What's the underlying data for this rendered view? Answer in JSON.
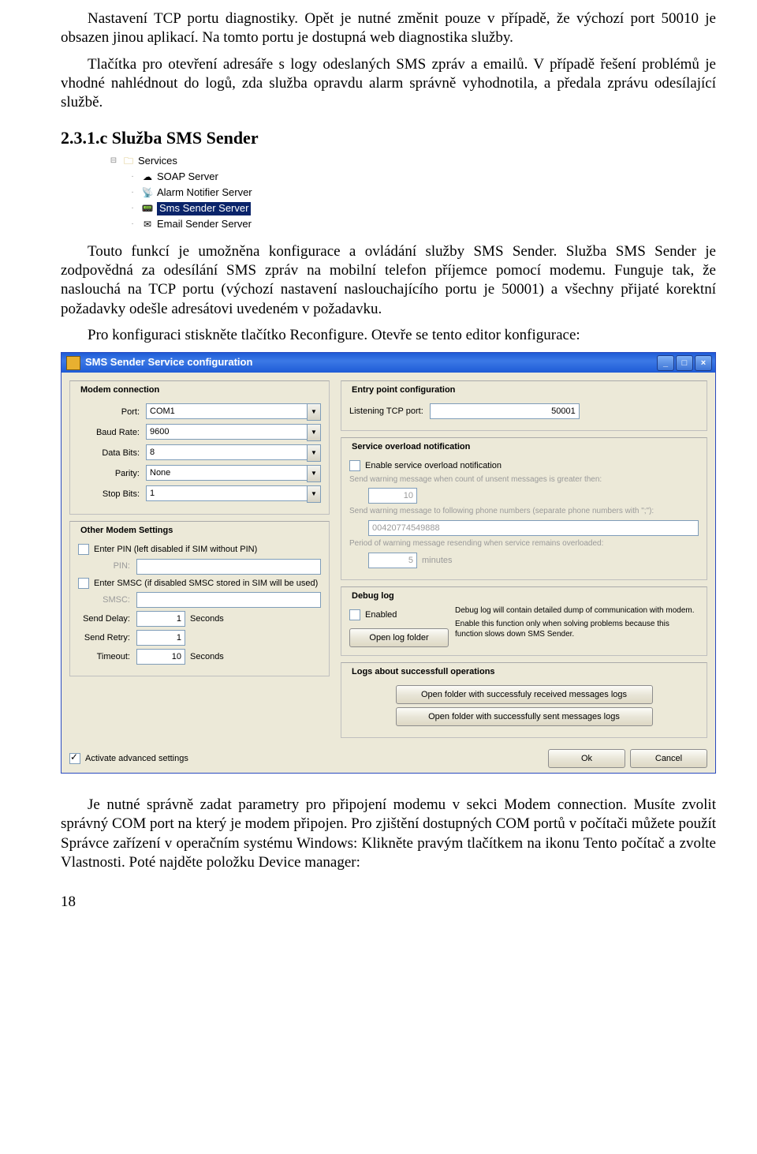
{
  "para1": "Nastavení TCP portu diagnostiky. Opět je nutné změnit pouze v případě, že výchozí port 50010 je obsazen jinou aplikací. Na tomto portu je dostupná web diagnostika služby.",
  "para2": "Tlačítka pro otevření adresáře s logy odeslaných SMS zpráv a emailů. V případě řešení problémů je vhodné nahlédnout do logů, zda služba opravdu alarm správně vyhodnotila, a předala zprávu odesílající službě.",
  "h2": "2.3.1.c Služba  SMS Sender",
  "tree": {
    "services": "Services",
    "soap": "SOAP Server",
    "alarm": "Alarm Notifier Server",
    "sms": "Sms Sender Server",
    "email": "Email Sender Server"
  },
  "para3": "Touto funkcí je umožněna konfigurace a ovládání služby SMS Sender. Služba SMS Sender je zodpovědná za odesílání SMS zpráv na mobilní telefon příjemce pomocí modemu. Funguje tak, že naslouchá na TCP portu (výchozí nastavení naslouchajícího portu je 50001) a všechny přijaté korektní požadavky odešle adresátovi uvedeném v požadavku.",
  "para4": "Pro konfiguraci stiskněte tlačítko Reconfigure. Otevře se tento editor konfigurace:",
  "win": {
    "title": "SMS Sender Service configuration",
    "modem": {
      "legend": "Modem connection",
      "port_l": "Port:",
      "port_v": "COM1",
      "baud_l": "Baud Rate:",
      "baud_v": "9600",
      "data_l": "Data Bits:",
      "data_v": "8",
      "parity_l": "Parity:",
      "parity_v": "None",
      "stop_l": "Stop Bits:",
      "stop_v": "1"
    },
    "other": {
      "legend": "Other Modem Settings",
      "pin_chk": "Enter PIN (left disabled if SIM without PIN)",
      "pin_l": "PIN:",
      "smsc_chk": "Enter SMSC (if disabled SMSC stored in SIM will be used)",
      "smsc_l": "SMSC:",
      "sd_l": "Send Delay:",
      "sd_v": "1",
      "sd_u": "Seconds",
      "sr_l": "Send Retry:",
      "sr_v": "1",
      "to_l": "Timeout:",
      "to_v": "10",
      "to_u": "Seconds"
    },
    "entry": {
      "legend": "Entry point configuration",
      "tcp_l": "Listening TCP port:",
      "tcp_v": "50001"
    },
    "overload": {
      "legend": "Service overload notification",
      "en": "Enable service overload notification",
      "t1": "Send warning message when count of unsent messages is greater then:",
      "v1": "10",
      "t2": "Send warning message to following phone numbers (separate phone numbers with \";\"):",
      "v2": "00420774549888",
      "t3": "Period of warning message resending when service remains overloaded:",
      "v3": "5",
      "u3": "minutes"
    },
    "debug": {
      "legend": "Debug log",
      "en": "Enabled",
      "btn": "Open log folder",
      "d1": "Debug log will contain detailed dump of communication with modem.",
      "d2": "Enable this function only when solving problems because this function slows down SMS Sender."
    },
    "logs": {
      "legend": "Logs about successfull operations",
      "b1": "Open folder with successfuly received messages logs",
      "b2": "Open folder with successfully sent messages logs"
    },
    "adv": "Activate advanced settings",
    "ok": "Ok",
    "cancel": "Cancel"
  },
  "para5": "Je nutné správně zadat parametry pro připojení modemu v sekci Modem connection. Musíte zvolit správný COM port na který je modem připojen. Pro zjištění dostupných COM portů v počítači můžete použít Správce zařízení v operačním systému Windows: Klikněte pravým tlačítkem na ikonu Tento počítač a zvolte Vlastnosti. Poté najděte položku Device manager:",
  "pagenum": "18"
}
